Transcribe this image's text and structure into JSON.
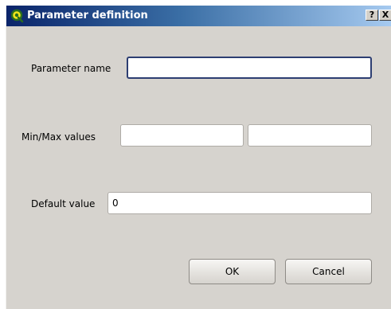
{
  "window": {
    "title": "Parameter definition",
    "help_label": "?",
    "close_label": "X"
  },
  "form": {
    "name_label": "Parameter name",
    "name_value": "",
    "minmax_label": "Min/Max values",
    "min_value": "",
    "max_value": "",
    "default_label": "Default value",
    "default_value": "0"
  },
  "buttons": {
    "ok_label": "OK",
    "cancel_label": "Cancel"
  },
  "icons": {
    "app": "qgis-icon"
  },
  "colors": {
    "titlebar_start": "#0a246a",
    "titlebar_end": "#a6caf0",
    "dialog_bg": "#d6d3ce",
    "focus_border": "#2d3e72"
  }
}
